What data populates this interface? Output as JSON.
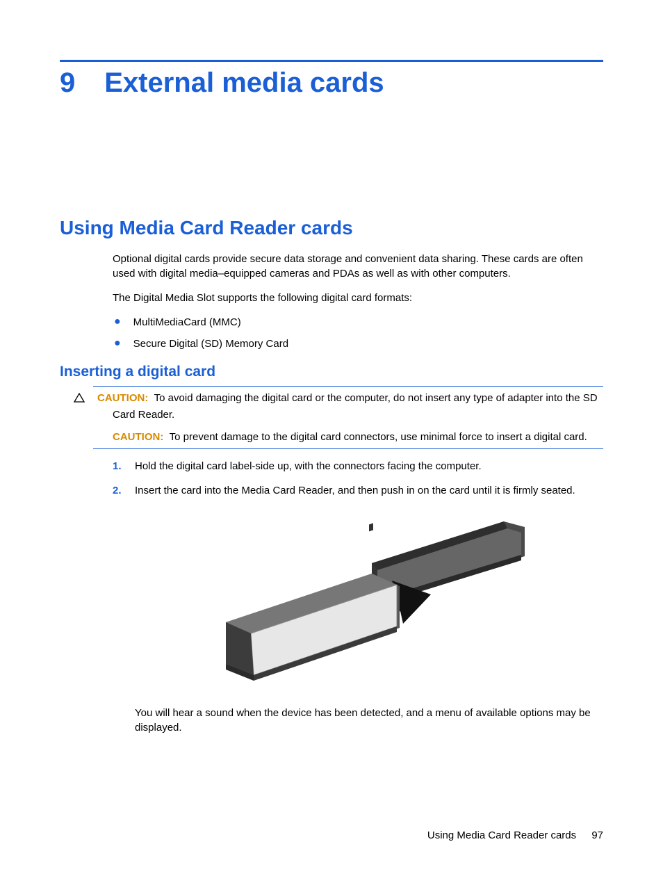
{
  "chapter": {
    "number": "9",
    "title": "External media cards"
  },
  "section": {
    "title": "Using Media Card Reader cards",
    "intro1": "Optional digital cards provide secure data storage and convenient data sharing. These cards are often used with digital media–equipped cameras and PDAs as well as with other computers.",
    "intro2": "The Digital Media Slot supports the following digital card formats:",
    "bullets": [
      "MultiMediaCard (MMC)",
      "Secure Digital (SD) Memory Card"
    ]
  },
  "subsection": {
    "title": "Inserting a digital card",
    "caution_label": "CAUTION:",
    "caution1": "To avoid damaging the digital card or the computer, do not insert any type of adapter into the SD Card Reader.",
    "caution2": "To prevent damage to the digital card connectors, use minimal force to insert a digital card.",
    "step1num": "1.",
    "step1": "Hold the digital card label-side up, with the connectors facing the computer.",
    "step2num": "2.",
    "step2": "Insert the card into the Media Card Reader, and then push in on the card until it is firmly seated.",
    "after_figure": "You will hear a sound when the device has been detected, and a menu of available options may be displayed."
  },
  "footer": {
    "text": "Using Media Card Reader cards",
    "page": "97"
  }
}
